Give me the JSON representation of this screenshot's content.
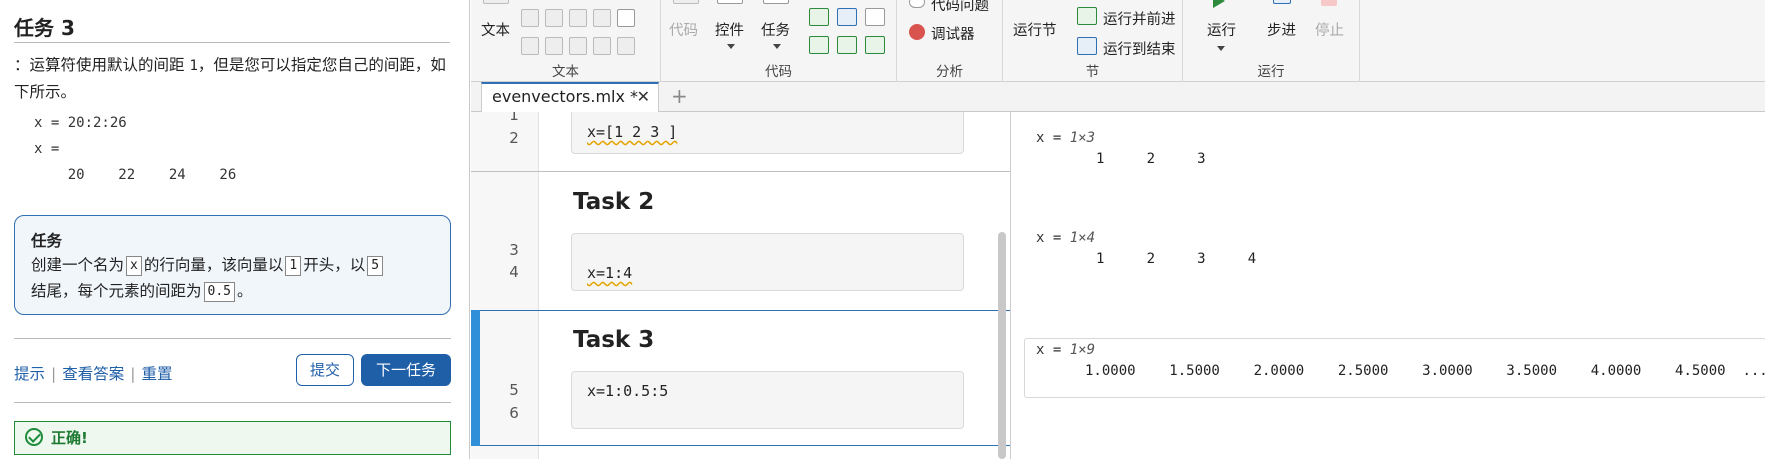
{
  "task_panel": {
    "title": "任务 3",
    "description_lead": "：运算符使用默认的间距 ",
    "description_code": "1",
    "description_tail": "，但是您可以指定您自己的间距，如下所示。",
    "example_lines": [
      "x = 20:2:26",
      "x =",
      "    20    22    24    26"
    ],
    "task_box": {
      "title": "任务",
      "t1": "创建一个名为",
      "c1": "x",
      "t2": "的行向量，该向量以",
      "c2": "1",
      "t3": "开头，以",
      "c3": "5",
      "t4": "结尾，每个元素的间距为",
      "c4": "0.5",
      "t5": "。"
    },
    "links": {
      "hint": "提示",
      "answer": "查看答案",
      "reset": "重置"
    },
    "submit_label": "提交",
    "next_label": "下一任务",
    "correct_label": "正确!"
  },
  "toolstrip": {
    "text_label": "文本",
    "text_section": "文本",
    "code_label": "代码",
    "control_label": "控件",
    "task_label": "任务",
    "code_section": "代码",
    "code_issues": "代码问题",
    "debugger": "调试器",
    "analysis_section": "分析",
    "run_section_btn": "运行节",
    "run_advance": "运行并前进",
    "run_to_end": "运行到结束",
    "section_section": "节",
    "run_btn": "运行",
    "step_btn": "步进",
    "stop_btn": "停止",
    "run_group": "运行"
  },
  "editor": {
    "tab_name": "evenvectors.mlx *",
    "line_numbers": [
      "1",
      "2",
      "3",
      "4",
      "5",
      "6"
    ],
    "code1": "x=[1 2 3 ]",
    "heading2": "Task 2",
    "code2": "x=1:4",
    "heading3": "Task 3",
    "code3": "x=1:0.5:5"
  },
  "output": {
    "o1_var": "x = ",
    "o1_size": "1×3",
    "o1_vals": "1     2     3",
    "o2_var": "x = ",
    "o2_size": "1×4",
    "o2_vals": "1     2     3     4",
    "o3_var": "x = ",
    "o3_size": "1×9",
    "o3_vals": "1.0000    1.5000    2.0000    2.5000    3.0000    3.5000    4.0000    4.5000  ..."
  }
}
